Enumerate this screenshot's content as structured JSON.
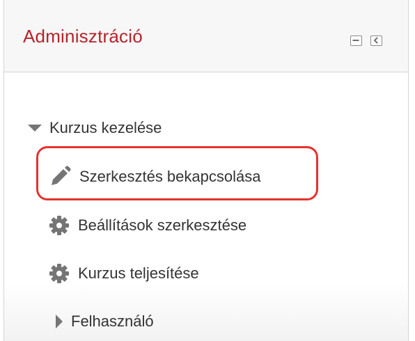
{
  "block": {
    "title": "Adminisztráció",
    "controls": {
      "minimize_icon": "minus-box-icon",
      "dock_icon": "dock-left-icon"
    }
  },
  "nav": {
    "section": {
      "label": "Kurzus kezelése",
      "icon": "triangle-down-icon",
      "expanded": true
    },
    "items": [
      {
        "label": "Szerkesztés bekapcsolása",
        "icon": "pencil-icon",
        "highlighted": true
      },
      {
        "label": "Beállítások szerkesztése",
        "icon": "gear-icon"
      },
      {
        "label": "Kurzus teljesítése",
        "icon": "gear-icon"
      }
    ],
    "subsection": {
      "label": "Felhasználó",
      "icon": "triangle-right-icon",
      "expanded": false
    }
  },
  "colors": {
    "title": "#b5232b",
    "text": "#333333",
    "icon": "#757575",
    "highlight_border": "#e5322d",
    "border": "#d4d4d4",
    "header_bg": "#f7f7f7"
  }
}
